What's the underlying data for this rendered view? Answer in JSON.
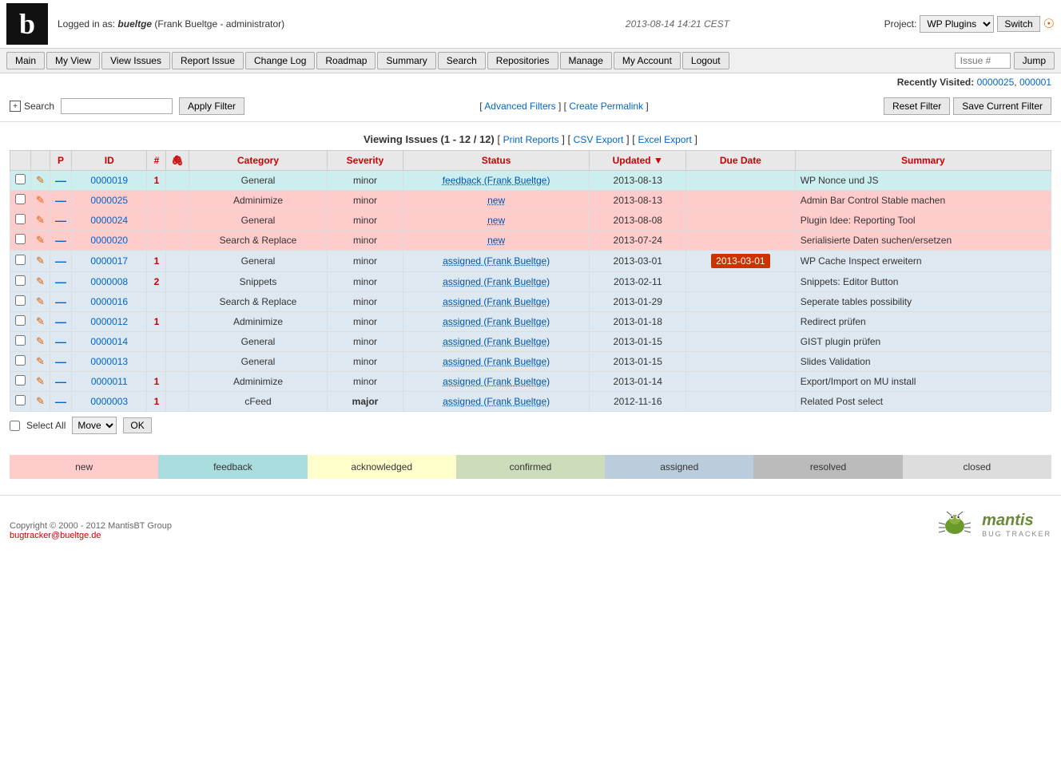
{
  "header": {
    "logo": "b",
    "login_text": "Logged in as:",
    "username": "bueltge",
    "user_display": "Frank Bueltge - administrator",
    "datetime": "2013-08-14 14:21 CEST",
    "project_label": "Project:",
    "project_value": "WP Plugins",
    "switch_label": "Switch"
  },
  "nav": {
    "items": [
      {
        "label": "Main",
        "name": "main"
      },
      {
        "label": "My View",
        "name": "my-view"
      },
      {
        "label": "View Issues",
        "name": "view-issues"
      },
      {
        "label": "Report Issue",
        "name": "report-issue"
      },
      {
        "label": "Change Log",
        "name": "change-log"
      },
      {
        "label": "Roadmap",
        "name": "roadmap"
      },
      {
        "label": "Summary",
        "name": "summary"
      },
      {
        "label": "Search",
        "name": "search"
      },
      {
        "label": "Repositories",
        "name": "repositories"
      },
      {
        "label": "Manage",
        "name": "manage"
      },
      {
        "label": "My Account",
        "name": "my-account"
      },
      {
        "label": "Logout",
        "name": "logout"
      }
    ],
    "issue_label": "Issue #",
    "jump_label": "Jump"
  },
  "recently_visited": {
    "label": "Recently Visited:",
    "links": [
      "0000025",
      "000001"
    ]
  },
  "filter": {
    "search_label": "Search",
    "search_placeholder": "",
    "apply_label": "Apply Filter",
    "advanced_filters": "Advanced Filters",
    "create_permalink": "Create Permalink",
    "reset_label": "Reset Filter",
    "save_label": "Save Current Filter"
  },
  "issues": {
    "viewing_text": "Viewing Issues (1 - 12 / 12)",
    "print_reports": "Print Reports",
    "csv_export": "CSV Export",
    "excel_export": "Excel Export",
    "columns": {
      "checkbox": "",
      "actions": "",
      "p": "P",
      "id": "ID",
      "num": "#",
      "clip": "🖇",
      "category": "Category",
      "severity": "Severity",
      "status": "Status",
      "updated": "Updated",
      "due_date": "Due Date",
      "summary": "Summary"
    },
    "rows": [
      {
        "id": "0000019",
        "p": "",
        "num": "1",
        "clip": "",
        "category": "General",
        "severity": "minor",
        "severity_bold": false,
        "status": "feedback",
        "status_person": "Frank Bueltge",
        "updated": "2013-08-13",
        "due_date": "",
        "due_date_red": false,
        "summary": "WP Nonce und JS",
        "row_class": "row-feedback"
      },
      {
        "id": "0000025",
        "p": "",
        "num": "",
        "clip": "",
        "category": "Adminimize",
        "severity": "minor",
        "severity_bold": false,
        "status": "new",
        "status_person": "",
        "updated": "2013-08-13",
        "due_date": "",
        "due_date_red": false,
        "summary": "Admin Bar Control Stable machen",
        "row_class": "row-new"
      },
      {
        "id": "0000024",
        "p": "",
        "num": "",
        "clip": "",
        "category": "General",
        "severity": "minor",
        "severity_bold": false,
        "status": "new",
        "status_person": "",
        "updated": "2013-08-08",
        "due_date": "",
        "due_date_red": false,
        "summary": "Plugin Idee: Reporting Tool",
        "row_class": "row-new"
      },
      {
        "id": "0000020",
        "p": "",
        "num": "",
        "clip": "",
        "category": "Search & Replace",
        "severity": "minor",
        "severity_bold": false,
        "status": "new",
        "status_person": "",
        "updated": "2013-07-24",
        "due_date": "",
        "due_date_red": false,
        "summary": "Serialisierte Daten suchen/ersetzen",
        "row_class": "row-new"
      },
      {
        "id": "0000017",
        "p": "",
        "num": "1",
        "clip": "",
        "category": "General",
        "severity": "minor",
        "severity_bold": false,
        "status": "assigned",
        "status_person": "Frank Bueltge",
        "updated": "2013-03-01",
        "due_date": "2013-03-01",
        "due_date_red": true,
        "summary": "WP Cache Inspect erweitern",
        "row_class": "row-assigned"
      },
      {
        "id": "0000008",
        "p": "",
        "num": "2",
        "clip": "",
        "category": "Snippets",
        "severity": "minor",
        "severity_bold": false,
        "status": "assigned",
        "status_person": "Frank Bueltge",
        "updated": "2013-02-11",
        "due_date": "",
        "due_date_red": false,
        "summary": "Snippets: Editor Button",
        "row_class": "row-assigned"
      },
      {
        "id": "0000016",
        "p": "",
        "num": "",
        "clip": "",
        "category": "Search & Replace",
        "severity": "minor",
        "severity_bold": false,
        "status": "assigned",
        "status_person": "Frank Bueltge",
        "updated": "2013-01-29",
        "due_date": "",
        "due_date_red": false,
        "summary": "Seperate tables possibility",
        "row_class": "row-assigned"
      },
      {
        "id": "0000012",
        "p": "",
        "num": "1",
        "clip": "",
        "category": "Adminimize",
        "severity": "minor",
        "severity_bold": false,
        "status": "assigned",
        "status_person": "Frank Bueltge",
        "updated": "2013-01-18",
        "due_date": "",
        "due_date_red": false,
        "summary": "Redirect prüfen",
        "row_class": "row-assigned"
      },
      {
        "id": "0000014",
        "p": "",
        "num": "",
        "clip": "",
        "category": "General",
        "severity": "minor",
        "severity_bold": false,
        "status": "assigned",
        "status_person": "Frank Bueltge",
        "updated": "2013-01-15",
        "due_date": "",
        "due_date_red": false,
        "summary": "GIST plugin prüfen",
        "row_class": "row-assigned"
      },
      {
        "id": "0000013",
        "p": "",
        "num": "",
        "clip": "",
        "category": "General",
        "severity": "minor",
        "severity_bold": false,
        "status": "assigned",
        "status_person": "Frank Bueltge",
        "updated": "2013-01-15",
        "due_date": "",
        "due_date_red": false,
        "summary": "Slides Validation",
        "row_class": "row-assigned"
      },
      {
        "id": "0000011",
        "p": "",
        "num": "1",
        "clip": "",
        "category": "Adminimize",
        "severity": "minor",
        "severity_bold": false,
        "status": "assigned",
        "status_person": "Frank Bueltge",
        "updated": "2013-01-14",
        "due_date": "",
        "due_date_red": false,
        "summary": "Export/Import on MU install",
        "row_class": "row-assigned"
      },
      {
        "id": "0000003",
        "p": "",
        "num": "1",
        "clip": "",
        "category": "cFeed",
        "severity": "major",
        "severity_bold": true,
        "status": "assigned",
        "status_person": "Frank Bueltge",
        "updated": "2012-11-16",
        "due_date": "",
        "due_date_red": false,
        "summary": "Related Post select",
        "row_class": "row-assigned"
      }
    ]
  },
  "select_all": {
    "label": "Select All",
    "move_label": "Move",
    "ok_label": "OK",
    "move_options": [
      "Move"
    ]
  },
  "legend": {
    "items": [
      {
        "label": "new",
        "class": "legend-new"
      },
      {
        "label": "feedback",
        "class": "legend-feedback"
      },
      {
        "label": "acknowledged",
        "class": "legend-acknowledged"
      },
      {
        "label": "confirmed",
        "class": "legend-confirmed"
      },
      {
        "label": "assigned",
        "class": "legend-assigned"
      },
      {
        "label": "resolved",
        "class": "legend-resolved"
      },
      {
        "label": "closed",
        "class": "legend-closed"
      }
    ]
  },
  "footer": {
    "copyright": "Copyright © 2000 - 2012 MantisBT Group",
    "email": "bugtracker@bueltge.de",
    "logo_text": "mantis BUG TRACKER"
  }
}
